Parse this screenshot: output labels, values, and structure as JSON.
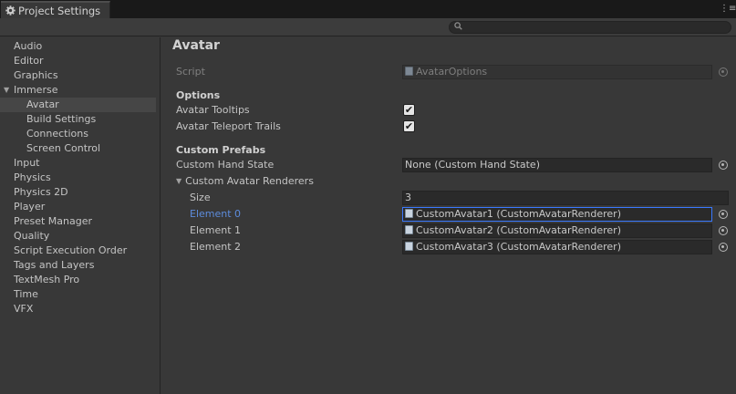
{
  "window": {
    "tab_title": "Project Settings",
    "tab_icon": "gear-icon",
    "menu_icon": "tab-menu-icon"
  },
  "search": {
    "placeholder": "",
    "icon": "search-icon"
  },
  "sidebar": {
    "items": [
      {
        "label": "Audio"
      },
      {
        "label": "Editor"
      },
      {
        "label": "Graphics"
      },
      {
        "label": "Immerse",
        "expanded": true
      },
      {
        "label": "Avatar",
        "selected": true
      },
      {
        "label": "Build Settings"
      },
      {
        "label": "Connections"
      },
      {
        "label": "Screen Control"
      },
      {
        "label": "Input"
      },
      {
        "label": "Physics"
      },
      {
        "label": "Physics 2D"
      },
      {
        "label": "Player"
      },
      {
        "label": "Preset Manager"
      },
      {
        "label": "Quality"
      },
      {
        "label": "Script Execution Order"
      },
      {
        "label": "Tags and Layers"
      },
      {
        "label": "TextMesh Pro"
      },
      {
        "label": "Time"
      },
      {
        "label": "VFX"
      }
    ]
  },
  "main": {
    "title": "Avatar",
    "script": {
      "label": "Script",
      "value": "AvatarOptions"
    },
    "options": {
      "header": "Options",
      "avatar_tooltips": {
        "label": "Avatar Tooltips",
        "checked": true
      },
      "avatar_teleport_trails": {
        "label": "Avatar Teleport Trails",
        "checked": true
      }
    },
    "custom_prefabs": {
      "header": "Custom Prefabs",
      "custom_hand_state": {
        "label": "Custom Hand State",
        "value": "None (Custom Hand State)"
      },
      "renderers": {
        "label": "Custom Avatar Renderers",
        "size_label": "Size",
        "size_value": "3",
        "elements": [
          {
            "label": "Element 0",
            "value": "CustomAvatar1 (CustomAvatarRenderer)"
          },
          {
            "label": "Element 1",
            "value": "CustomAvatar2 (CustomAvatarRenderer)"
          },
          {
            "label": "Element 2",
            "value": "CustomAvatar3 (CustomAvatarRenderer)"
          }
        ]
      }
    },
    "check_glyph": "✔"
  },
  "colors": {
    "background": "#383838",
    "tabbar": "#191919",
    "field": "#2a2a2a",
    "focus_border": "#3a79ff",
    "highlight_label": "#5d8cdc"
  }
}
